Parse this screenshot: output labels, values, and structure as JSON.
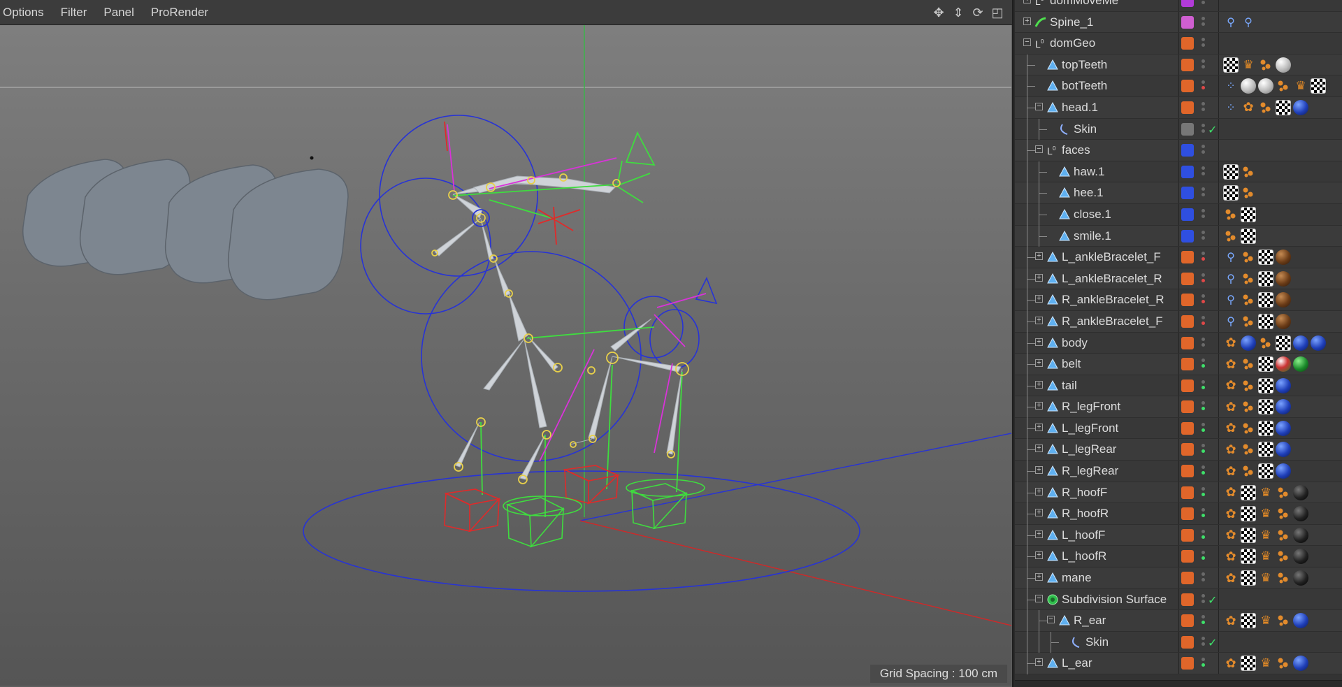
{
  "menubar": {
    "items": [
      "Options",
      "Filter",
      "Panel",
      "ProRender"
    ]
  },
  "nav_icons": [
    "move-view-icon",
    "dolly-view-icon",
    "rotate-view-icon",
    "maximize-view-icon"
  ],
  "viewport": {
    "grid_spacing": "Grid Spacing : 100 cm"
  },
  "colors": {
    "layer_orange": "#e0662a",
    "layer_blue": "#2f4fe0",
    "layer_magenta": "#cf5fd1",
    "layer_purple": "#b23bd8",
    "active_green": "#3ee06a",
    "viewport_bg": "#6f6f6f"
  },
  "objects": [
    {
      "name": "domMoveMe",
      "indent": 0,
      "expander": "+",
      "icon": "null",
      "layer": "#b23bd8",
      "dot": "",
      "check": false,
      "tags": []
    },
    {
      "name": "Spine_1",
      "indent": 0,
      "expander": "+",
      "icon": "spline",
      "layer": "#cf5fd1",
      "dot": "",
      "check": false,
      "tags": [
        "spline",
        "spline"
      ]
    },
    {
      "name": "domGeo",
      "indent": 0,
      "expander": "-",
      "icon": "null",
      "layer": "#e0662a",
      "dot": "",
      "check": false,
      "tags": []
    },
    {
      "name": "topTeeth",
      "indent": 1,
      "expander": "",
      "icon": "poly",
      "layer": "#e0662a",
      "dot": "",
      "check": false,
      "tags": [
        "checker",
        "weight",
        "dots",
        "ball-white"
      ]
    },
    {
      "name": "botTeeth",
      "indent": 1,
      "expander": "",
      "icon": "poly",
      "layer": "#e0662a",
      "dot": "red",
      "check": false,
      "tags": [
        "points",
        "ball-white",
        "ball-white",
        "dots",
        "weight",
        "checker"
      ]
    },
    {
      "name": "head.1",
      "indent": 1,
      "expander": "-",
      "icon": "poly",
      "layer": "#e0662a",
      "dot": "",
      "check": false,
      "tags": [
        "points",
        "xpresso",
        "dots",
        "checker",
        "ball-blue"
      ]
    },
    {
      "name": "Skin",
      "indent": 2,
      "expander": "",
      "icon": "skin",
      "layer": "#777777",
      "dot": "",
      "check": true,
      "tags": []
    },
    {
      "name": "faces",
      "indent": 1,
      "expander": "-",
      "icon": "null",
      "layer": "#2f4fe0",
      "dot": "",
      "check": false,
      "tags": []
    },
    {
      "name": "haw.1",
      "indent": 2,
      "expander": "",
      "icon": "poly",
      "layer": "#2f4fe0",
      "dot": "",
      "check": false,
      "tags": [
        "checker",
        "dots"
      ]
    },
    {
      "name": "hee.1",
      "indent": 2,
      "expander": "",
      "icon": "poly",
      "layer": "#2f4fe0",
      "dot": "",
      "check": false,
      "tags": [
        "checker",
        "dots"
      ]
    },
    {
      "name": "close.1",
      "indent": 2,
      "expander": "",
      "icon": "poly",
      "layer": "#2f4fe0",
      "dot": "",
      "check": false,
      "tags": [
        "dots",
        "checker"
      ]
    },
    {
      "name": "smile.1",
      "indent": 2,
      "expander": "",
      "icon": "poly",
      "layer": "#2f4fe0",
      "dot": "",
      "check": false,
      "tags": [
        "dots",
        "checker"
      ]
    },
    {
      "name": "L_ankleBracelet_F",
      "indent": 1,
      "expander": "+",
      "icon": "poly",
      "layer": "#e0662a",
      "dot": "red",
      "check": false,
      "tags": [
        "spline",
        "dots",
        "checker",
        "ball-brown"
      ]
    },
    {
      "name": "L_ankleBracelet_R",
      "indent": 1,
      "expander": "+",
      "icon": "poly",
      "layer": "#e0662a",
      "dot": "red",
      "check": false,
      "tags": [
        "spline",
        "dots",
        "checker",
        "ball-brown"
      ]
    },
    {
      "name": "R_ankleBracelet_R",
      "indent": 1,
      "expander": "+",
      "icon": "poly",
      "layer": "#e0662a",
      "dot": "red",
      "check": false,
      "tags": [
        "spline",
        "dots",
        "checker",
        "ball-brown"
      ]
    },
    {
      "name": "R_ankleBracelet_F",
      "indent": 1,
      "expander": "+",
      "icon": "poly",
      "layer": "#e0662a",
      "dot": "red",
      "check": false,
      "tags": [
        "spline",
        "dots",
        "checker",
        "ball-brown"
      ]
    },
    {
      "name": "body",
      "indent": 1,
      "expander": "+",
      "icon": "poly",
      "layer": "#e0662a",
      "dot": "",
      "check": false,
      "tags": [
        "xpresso",
        "ball-blue",
        "dots",
        "checker",
        "ball-blue",
        "ball-blue"
      ]
    },
    {
      "name": "belt",
      "indent": 1,
      "expander": "+",
      "icon": "poly",
      "layer": "#e0662a",
      "dot": "green",
      "check": false,
      "tags": [
        "xpresso",
        "dots",
        "checker",
        "ball-mixed",
        "ball-green"
      ]
    },
    {
      "name": "tail",
      "indent": 1,
      "expander": "+",
      "icon": "poly",
      "layer": "#e0662a",
      "dot": "green",
      "check": false,
      "tags": [
        "xpresso",
        "dots",
        "checker",
        "ball-blue"
      ]
    },
    {
      "name": "R_legFront",
      "indent": 1,
      "expander": "+",
      "icon": "poly",
      "layer": "#e0662a",
      "dot": "green",
      "check": false,
      "tags": [
        "xpresso",
        "dots",
        "checker",
        "ball-blue"
      ]
    },
    {
      "name": "L_legFront",
      "indent": 1,
      "expander": "+",
      "icon": "poly",
      "layer": "#e0662a",
      "dot": "green",
      "check": false,
      "tags": [
        "xpresso",
        "dots",
        "checker",
        "ball-blue"
      ]
    },
    {
      "name": "L_legRear",
      "indent": 1,
      "expander": "+",
      "icon": "poly",
      "layer": "#e0662a",
      "dot": "green",
      "check": false,
      "tags": [
        "xpresso",
        "dots",
        "checker",
        "ball-blue"
      ]
    },
    {
      "name": "R_legRear",
      "indent": 1,
      "expander": "+",
      "icon": "poly",
      "layer": "#e0662a",
      "dot": "green",
      "check": false,
      "tags": [
        "xpresso",
        "dots",
        "checker",
        "ball-blue"
      ]
    },
    {
      "name": "R_hoofF",
      "indent": 1,
      "expander": "+",
      "icon": "poly",
      "layer": "#e0662a",
      "dot": "green",
      "check": false,
      "tags": [
        "xpresso",
        "checker",
        "weight",
        "dots",
        "ball-black"
      ]
    },
    {
      "name": "R_hoofR",
      "indent": 1,
      "expander": "+",
      "icon": "poly",
      "layer": "#e0662a",
      "dot": "green",
      "check": false,
      "tags": [
        "xpresso",
        "checker",
        "weight",
        "dots",
        "ball-black"
      ]
    },
    {
      "name": "L_hoofF",
      "indent": 1,
      "expander": "+",
      "icon": "poly",
      "layer": "#e0662a",
      "dot": "green",
      "check": false,
      "tags": [
        "xpresso",
        "checker",
        "weight",
        "dots",
        "ball-black"
      ]
    },
    {
      "name": "L_hoofR",
      "indent": 1,
      "expander": "+",
      "icon": "poly",
      "layer": "#e0662a",
      "dot": "green",
      "check": false,
      "tags": [
        "xpresso",
        "checker",
        "weight",
        "dots",
        "ball-black"
      ]
    },
    {
      "name": "mane",
      "indent": 1,
      "expander": "+",
      "icon": "poly",
      "layer": "#e0662a",
      "dot": "",
      "check": false,
      "tags": [
        "xpresso",
        "checker",
        "weight",
        "dots",
        "ball-black"
      ]
    },
    {
      "name": "Subdivision Surface",
      "indent": 1,
      "expander": "-",
      "icon": "subdiv",
      "layer": "#e0662a",
      "dot": "",
      "check": true,
      "tags": []
    },
    {
      "name": "R_ear",
      "indent": 2,
      "expander": "-",
      "icon": "poly",
      "layer": "#e0662a",
      "dot": "green",
      "check": false,
      "tags": [
        "xpresso",
        "checker",
        "weight",
        "dots",
        "ball-blue"
      ]
    },
    {
      "name": "Skin",
      "indent": 3,
      "expander": "",
      "icon": "skin",
      "layer": "#e0662a",
      "dot": "",
      "check": true,
      "tags": []
    },
    {
      "name": "L_ear",
      "indent": 1,
      "expander": "+",
      "icon": "poly",
      "layer": "#e0662a",
      "dot": "green",
      "check": false,
      "tags": [
        "xpresso",
        "checker",
        "weight",
        "dots",
        "ball-blue"
      ]
    }
  ]
}
